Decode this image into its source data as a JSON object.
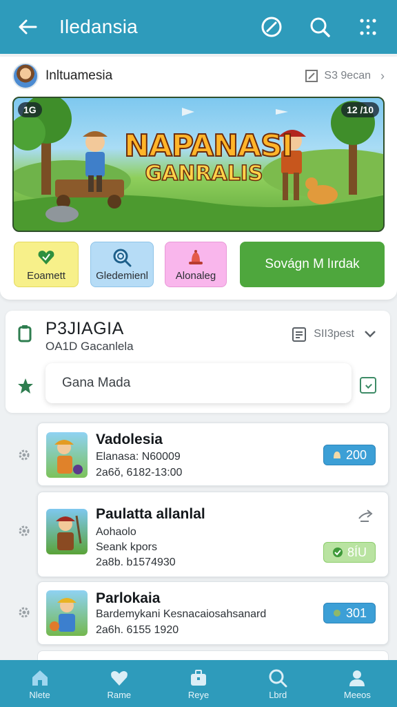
{
  "appbar": {
    "title": "Iledansia",
    "icons": [
      "back-arrow-icon",
      "compass-icon",
      "search-icon",
      "more-grid-icon"
    ]
  },
  "profile": {
    "name": "Inltuamesia",
    "meta": "S3 9ecan",
    "icons": [
      "edit-icon",
      "chevron-right-icon"
    ]
  },
  "banner": {
    "hud_left": "1G",
    "hud_right": "12 /10",
    "title_line1": "NAPANASI",
    "title_line2": "GANRALIS"
  },
  "chips": [
    {
      "label": "Eoamett",
      "icon": "heart-icon"
    },
    {
      "label": "Gledemienl",
      "icon": "magnifier-icon"
    },
    {
      "label": "Alonaleg",
      "icon": "bell-icon"
    },
    {
      "label": "Sovágn M lırdak",
      "icon": ""
    }
  ],
  "section": {
    "title": "P3JIAGIA",
    "subtitle": "OA1D Gacanlela",
    "right_label": "SII3pest",
    "search_value": "Gana Mada",
    "icons": [
      "clipboard-icon",
      "star-icon",
      "chevron-down-icon",
      "checkbox-icon"
    ]
  },
  "items": [
    {
      "title": "Vadolesia",
      "lines": [
        "Elanasa: N60009",
        "2a6ŏ, 6182-13:00"
      ],
      "badge": "200",
      "badge_style": "blue"
    },
    {
      "title": "Paulatta allanlal",
      "lines": [
        "Aohaolo",
        "Seank kpors",
        "2a8b. b1574930"
      ],
      "badge": "8ÍU",
      "badge_style": "green"
    },
    {
      "title": "Parlokaia",
      "lines": [
        "Bardemykani Kesnacaiosahsanard",
        "2a6h. 6155 1920"
      ],
      "badge": "301",
      "badge_style": "blue"
    }
  ],
  "bottom_nav": [
    {
      "label": "Nlete",
      "icon": "home-icon"
    },
    {
      "label": "Rame",
      "icon": "heart-icon"
    },
    {
      "label": "Reye",
      "icon": "briefcase-icon"
    },
    {
      "label": "Lbrd",
      "icon": "search-icon"
    },
    {
      "label": "Meeos",
      "icon": "person-icon"
    }
  ],
  "colors": {
    "primary": "#2e9bbb",
    "accent_green": "#4ea73d",
    "badge_blue": "#3c9fd6",
    "badge_green": "#b9e3a1"
  }
}
